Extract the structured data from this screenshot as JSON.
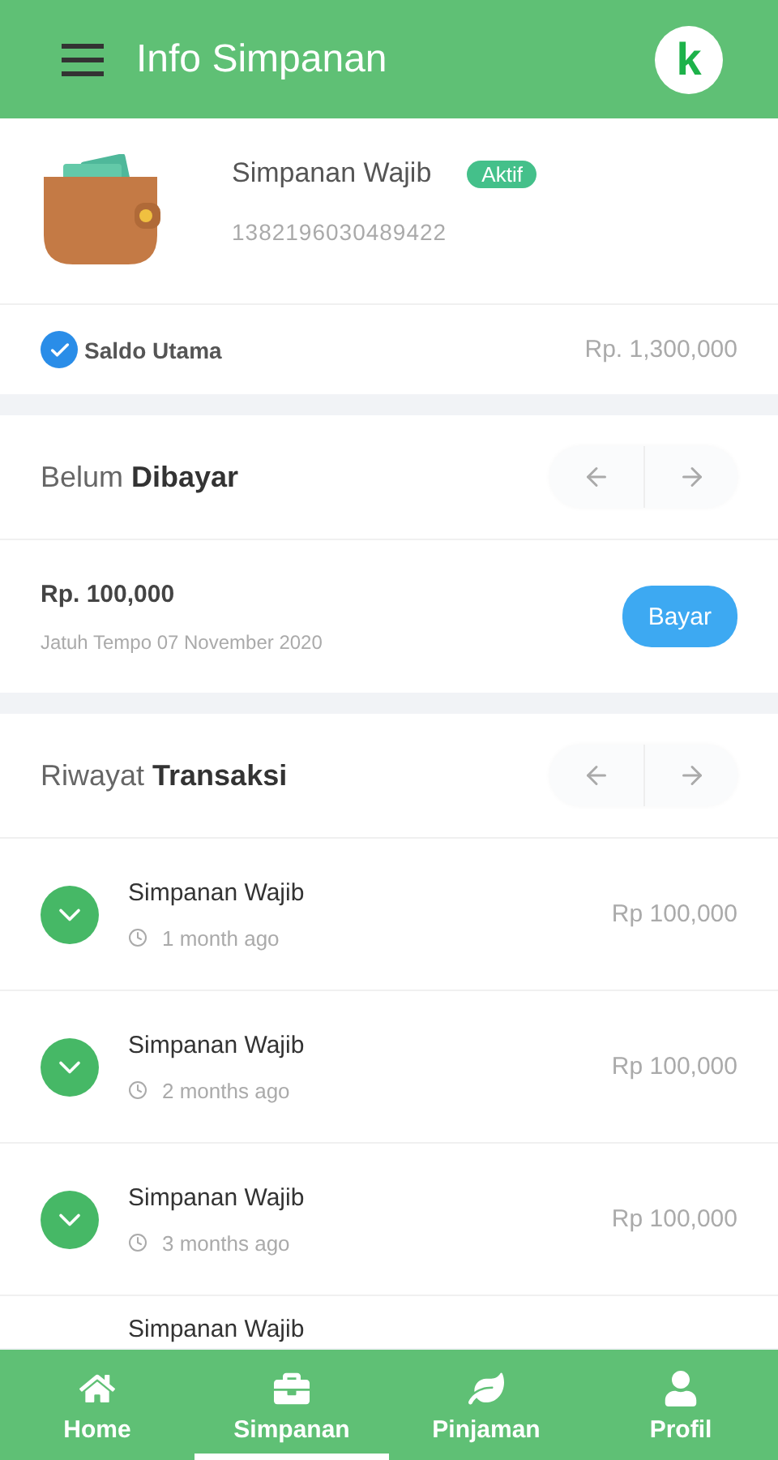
{
  "header": {
    "title": "Info Simpanan",
    "logo": "k"
  },
  "account": {
    "name": "Simpanan Wajib",
    "status": "Aktif",
    "number": "1382196030489422",
    "balance_label": "Saldo Utama",
    "balance_checked": true,
    "balance": "Rp. 1,300,000"
  },
  "unpaid": {
    "title": "Belum **Dibayar**",
    "amount": "Rp. 100,000",
    "due": "Jatuh Tempo 07 November 2020",
    "button": "Bayar"
  },
  "history": {
    "title": "Riwayat **Transaksi**",
    "rows": [
      {
        "name": "Simpanan Wajib",
        "time": "1 month ago",
        "amount": "Rp 100,000"
      },
      {
        "name": "Simpanan Wajib",
        "time": "2 months ago",
        "amount": "Rp 100,000"
      },
      {
        "name": "Simpanan Wajib",
        "time": "3 months ago",
        "amount": "Rp 100,000"
      },
      {
        "name": "Simpanan Wajib"
      }
    ]
  },
  "nav": [
    {
      "label": "Home",
      "kind": "home",
      "selected": false
    },
    {
      "label": "Simpanan",
      "kind": "briefcase",
      "selected": true
    },
    {
      "label": "Pinjaman",
      "kind": "leaf",
      "selected": false
    },
    {
      "label": "Profil",
      "kind": "user",
      "selected": false
    }
  ]
}
